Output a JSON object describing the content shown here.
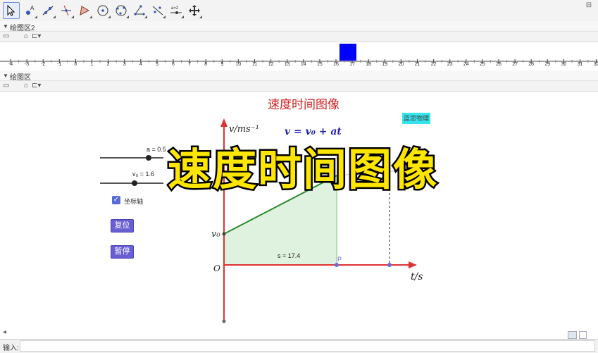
{
  "toolbar": {
    "tools": [
      "move-tool",
      "point-tool",
      "line-tool",
      "perpendicular-tool",
      "polygon-tool",
      "circle-tool",
      "circle-three-points-tool",
      "angle-tool",
      "reflect-tool",
      "slider-tool",
      "move-graphics-tool"
    ],
    "slider_tool_text": "a=2"
  },
  "panels": {
    "graphics2_title": "绘图区2",
    "graphics_title": "绘图区"
  },
  "numberline": {
    "ticks": [
      "-4",
      "-3",
      "-2",
      "-1",
      "0",
      "1",
      "2",
      "3",
      "4",
      "5",
      "6",
      "7",
      "8",
      "9",
      "10",
      "11",
      "12",
      "13",
      "14",
      "15",
      "16",
      "17",
      "18",
      "19",
      "20",
      "21",
      "22",
      "23",
      "24",
      "25",
      "26",
      "27",
      "28",
      "29",
      "30",
      "31",
      "32"
    ],
    "square_color": "#0000ff"
  },
  "graph": {
    "title": "速度时间图像",
    "tag": "蓝思物理",
    "formula": "v = v₀ + at",
    "y_axis_label": "v/ms⁻¹",
    "x_axis_label": "t/s",
    "origin_label": "O",
    "v0_label": "v₀",
    "area_label": "s = 17.4",
    "point_label": "P",
    "overlay_title": "速度时间图像",
    "accent_axis": "#e03030",
    "line_color": "#2a8a2a",
    "fill_color": "#d6efd6"
  },
  "controls": {
    "slider_a_label": "a = 0.5",
    "slider_v0_label": "v₀ = 1.6",
    "checkbox_label": "坐标轴",
    "reset_label": "复位",
    "pause_label": "暂停"
  },
  "input_bar": {
    "label": "输入:"
  }
}
